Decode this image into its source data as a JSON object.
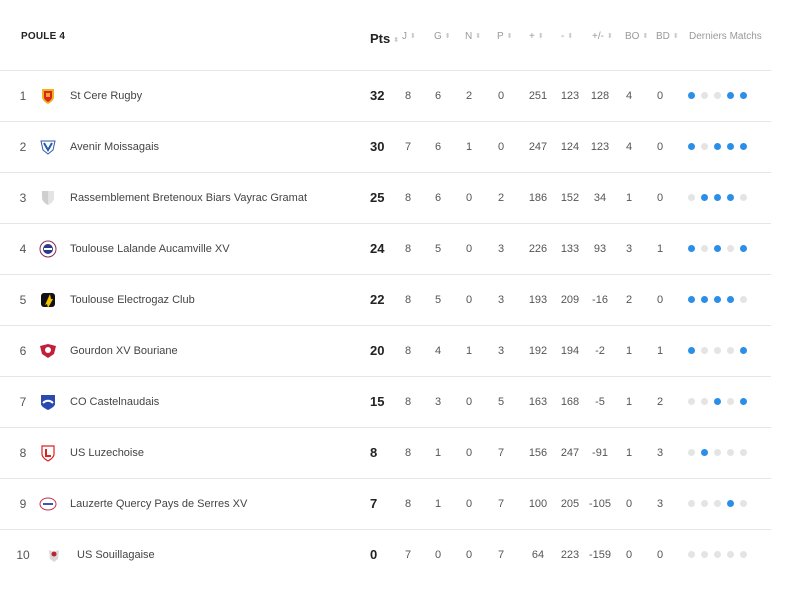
{
  "table": {
    "title": "POULE 4",
    "headers": {
      "pts": "Pts",
      "j": "J",
      "g": "G",
      "n": "N",
      "p": "P",
      "plus": "+",
      "minus": "-",
      "diff": "+/-",
      "bo": "BO",
      "bd": "BD",
      "last": "Derniers Matchs"
    },
    "colors": {
      "win": "#2b8fe8",
      "other": "#e4e4e4"
    },
    "rows": [
      {
        "rank": "1",
        "team": "St Cere Rugby",
        "logo": "st-cere-rugby-logo",
        "pts": "32",
        "j": "8",
        "g": "6",
        "n": "2",
        "p": "0",
        "plus": "251",
        "minus": "123",
        "diff": "128",
        "bo": "4",
        "bd": "0",
        "form": [
          1,
          0,
          0,
          1,
          1
        ]
      },
      {
        "rank": "2",
        "team": "Avenir Moissagais",
        "logo": "avenir-moissagais-logo",
        "pts": "30",
        "j": "7",
        "g": "6",
        "n": "1",
        "p": "0",
        "plus": "247",
        "minus": "124",
        "diff": "123",
        "bo": "4",
        "bd": "0",
        "form": [
          1,
          0,
          1,
          1,
          1
        ]
      },
      {
        "rank": "3",
        "team": "Rassemblement Bretenoux Biars Vayrac Gramat",
        "logo": "placeholder-shield-logo",
        "pts": "25",
        "j": "8",
        "g": "6",
        "n": "0",
        "p": "2",
        "plus": "186",
        "minus": "152",
        "diff": "34",
        "bo": "1",
        "bd": "0",
        "form": [
          0,
          1,
          1,
          1,
          0
        ]
      },
      {
        "rank": "4",
        "team": "Toulouse Lalande Aucamville XV",
        "logo": "toulouse-lalande-logo",
        "pts": "24",
        "j": "8",
        "g": "5",
        "n": "0",
        "p": "3",
        "plus": "226",
        "minus": "133",
        "diff": "93",
        "bo": "3",
        "bd": "1",
        "form": [
          1,
          0,
          1,
          0,
          1
        ]
      },
      {
        "rank": "5",
        "team": "Toulouse Electrogaz Club",
        "logo": "toulouse-electrogaz-logo",
        "pts": "22",
        "j": "8",
        "g": "5",
        "n": "0",
        "p": "3",
        "plus": "193",
        "minus": "209",
        "diff": "-16",
        "bo": "2",
        "bd": "0",
        "form": [
          1,
          1,
          1,
          1,
          0
        ]
      },
      {
        "rank": "6",
        "team": "Gourdon XV Bouriane",
        "logo": "gourdon-logo",
        "pts": "20",
        "j": "8",
        "g": "4",
        "n": "1",
        "p": "3",
        "plus": "192",
        "minus": "194",
        "diff": "-2",
        "bo": "1",
        "bd": "1",
        "form": [
          1,
          0,
          0,
          0,
          1
        ]
      },
      {
        "rank": "7",
        "team": "CO Castelnaudais",
        "logo": "co-castelnaudais-logo",
        "pts": "15",
        "j": "8",
        "g": "3",
        "n": "0",
        "p": "5",
        "plus": "163",
        "minus": "168",
        "diff": "-5",
        "bo": "1",
        "bd": "2",
        "form": [
          0,
          0,
          1,
          0,
          1
        ]
      },
      {
        "rank": "8",
        "team": "US Luzechoise",
        "logo": "us-luzechoise-logo",
        "pts": "8",
        "j": "8",
        "g": "1",
        "n": "0",
        "p": "7",
        "plus": "156",
        "minus": "247",
        "diff": "-91",
        "bo": "1",
        "bd": "3",
        "form": [
          0,
          1,
          0,
          0,
          0
        ]
      },
      {
        "rank": "9",
        "team": "Lauzerte Quercy Pays de Serres XV",
        "logo": "lauzerte-logo",
        "pts": "7",
        "j": "8",
        "g": "1",
        "n": "0",
        "p": "7",
        "plus": "100",
        "minus": "205",
        "diff": "-105",
        "bo": "0",
        "bd": "3",
        "form": [
          0,
          0,
          0,
          1,
          0
        ]
      },
      {
        "rank": "10",
        "team": "US Souillagaise",
        "logo": "us-souillagaise-logo",
        "pts": "0",
        "j": "7",
        "g": "0",
        "n": "0",
        "p": "7",
        "plus": "64",
        "minus": "223",
        "diff": "-159",
        "bo": "0",
        "bd": "0",
        "form": [
          0,
          0,
          0,
          0,
          0
        ]
      }
    ]
  }
}
